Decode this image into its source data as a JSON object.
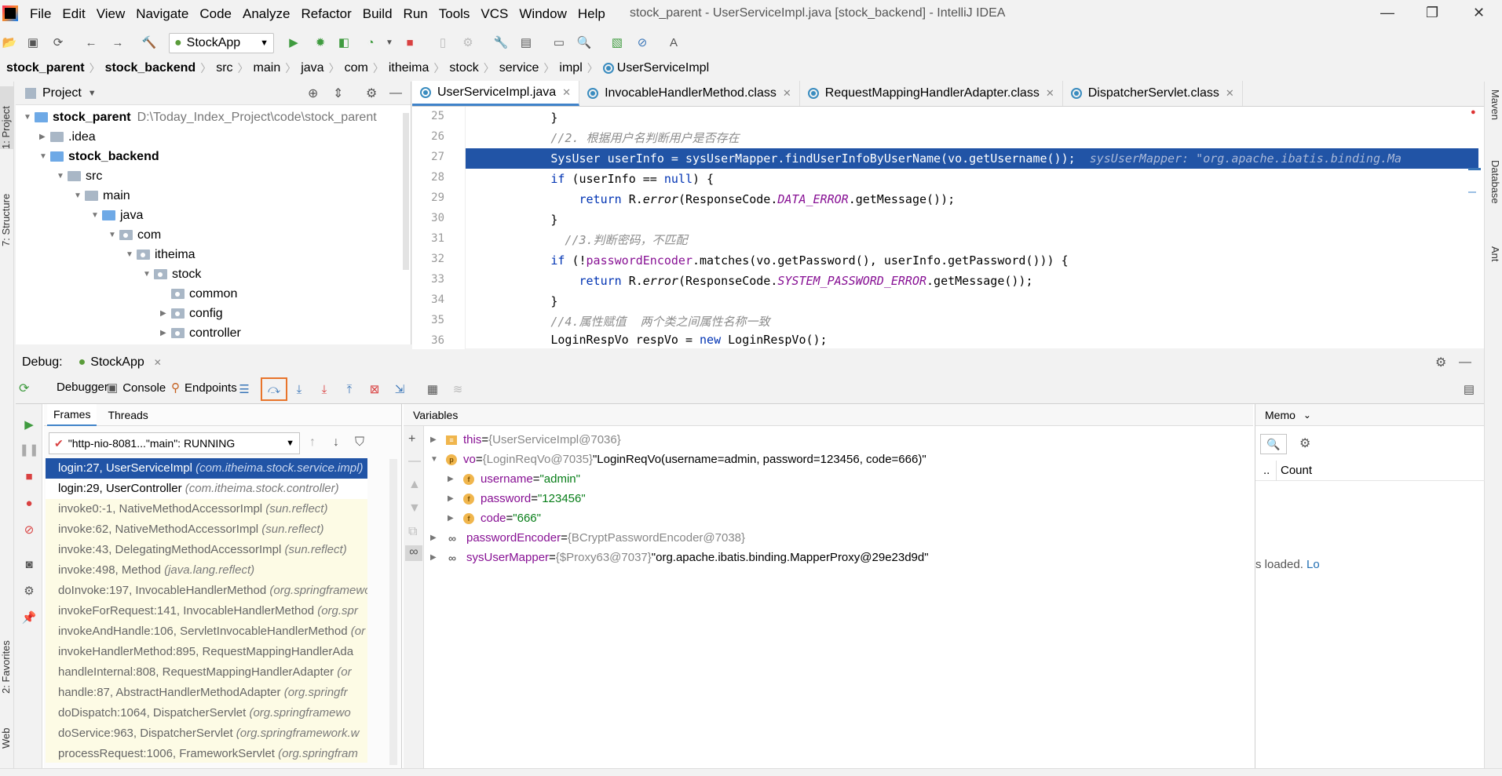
{
  "window": {
    "title": "stock_parent - UserServiceImpl.java [stock_backend] - IntelliJ IDEA"
  },
  "menu": [
    "File",
    "Edit",
    "View",
    "Navigate",
    "Code",
    "Analyze",
    "Refactor",
    "Build",
    "Run",
    "Tools",
    "VCS",
    "Window",
    "Help"
  ],
  "toolbar": {
    "run_config": "StockApp"
  },
  "breadcrumbs": [
    "stock_parent",
    "stock_backend",
    "src",
    "main",
    "java",
    "com",
    "itheima",
    "stock",
    "service",
    "impl",
    "UserServiceImpl"
  ],
  "left_stripe": {
    "project": "1: Project",
    "structure": "7: Structure",
    "favorites": "2: Favorites",
    "web": "Web"
  },
  "right_stripe": {
    "maven": "Maven",
    "database": "Database",
    "ant": "Ant"
  },
  "project": {
    "title": "Project",
    "root": {
      "name": "stock_parent",
      "path": "D:\\Today_Index_Project\\code\\stock_parent"
    },
    "items": [
      "stock_parent",
      ".idea",
      "stock_backend",
      "src",
      "main",
      "java",
      "com",
      "itheima",
      "stock",
      "common",
      "config",
      "controller"
    ]
  },
  "editor": {
    "tabs": [
      "UserServiceImpl.java",
      "InvocableHandlerMethod.class",
      "RequestMappingHandlerAdapter.class",
      "DispatcherServlet.class"
    ],
    "line_numbers": [
      "25",
      "26",
      "27",
      "28",
      "29",
      "30",
      "31",
      "32",
      "33",
      "34",
      "35",
      "36"
    ],
    "lines": {
      "l25": "            }",
      "l26": "            //2. 根据用户名判断用户是否存在",
      "l27a": "            SysUser userInfo = sysUserMapper.findUserInfoByUserName(vo.getUsername());",
      "l27b": "  sysUserMapper: \"org.apache.ibatis.binding.Ma",
      "l28a": "            ",
      "l28b": "if",
      "l28c": " (userInfo == ",
      "l28d": "null",
      "l28e": ") {",
      "l29a": "                ",
      "l29b": "return",
      "l29c": " R.",
      "l29d": "error",
      "l29e": "(ResponseCode.",
      "l29f": "DATA_ERROR",
      "l29g": ".getMessage());",
      "l30": "            }",
      "l31": "              //3.判断密码，不匹配",
      "l32a": "            ",
      "l32b": "if",
      "l32c": " (!",
      "l32d": "passwordEncoder",
      "l32e": ".matches(vo.getPassword(), userInfo.getPassword())) {",
      "l33a": "                ",
      "l33b": "return",
      "l33c": " R.",
      "l33d": "error",
      "l33e": "(ResponseCode.",
      "l33f": "SYSTEM_PASSWORD_ERROR",
      "l33g": ".getMessage());",
      "l34": "            }",
      "l35": "            //4.属性赋值  两个类之间属性名称一致",
      "l36a": "            LoginRespVo respVo = ",
      "l36b": "new",
      "l36c": " LoginRespVo();"
    }
  },
  "debug": {
    "label": "Debug:",
    "config": "StockApp",
    "tabs": {
      "debugger": "Debugger",
      "console": "Console",
      "endpoints": "Endpoints"
    },
    "frames_tab": "Frames",
    "threads_tab": "Threads",
    "thread_select": "\"http-nio-8081...\"main\": RUNNING",
    "frames": [
      {
        "m": "login:27, UserServiceImpl ",
        "p": "(com.itheima.stock.service.impl)"
      },
      {
        "m": "login:29, UserController ",
        "p": "(com.itheima.stock.controller)"
      },
      {
        "m": "invoke0:-1, NativeMethodAccessorImpl ",
        "p": "(sun.reflect)"
      },
      {
        "m": "invoke:62, NativeMethodAccessorImpl ",
        "p": "(sun.reflect)"
      },
      {
        "m": "invoke:43, DelegatingMethodAccessorImpl ",
        "p": "(sun.reflect)"
      },
      {
        "m": "invoke:498, Method ",
        "p": "(java.lang.reflect)"
      },
      {
        "m": "doInvoke:197, InvocableHandlerMethod ",
        "p": "(org.springframework"
      },
      {
        "m": "invokeForRequest:141, InvocableHandlerMethod ",
        "p": "(org.spr"
      },
      {
        "m": "invokeAndHandle:106, ServletInvocableHandlerMethod ",
        "p": "(or"
      },
      {
        "m": "invokeHandlerMethod:895, RequestMappingHandlerAda",
        "p": ""
      },
      {
        "m": "handleInternal:808, RequestMappingHandlerAdapter ",
        "p": "(or"
      },
      {
        "m": "handle:87, AbstractHandlerMethodAdapter ",
        "p": "(org.springfr"
      },
      {
        "m": "doDispatch:1064, DispatcherServlet ",
        "p": "(org.springframewo"
      },
      {
        "m": "doService:963, DispatcherServlet ",
        "p": "(org.springframework.w"
      },
      {
        "m": "processRequest:1006, FrameworkServlet ",
        "p": "(org.springfram"
      }
    ],
    "variables_label": "Variables",
    "variables": {
      "this": {
        "name": "this",
        "eq": " = ",
        "type": "{UserServiceImpl@7036}"
      },
      "vo": {
        "name": "vo",
        "eq": " = ",
        "type": "{LoginReqVo@7035} ",
        "val": "\"LoginReqVo(username=admin, password=123456, code=666)\""
      },
      "username": {
        "name": "username",
        "eq": " = ",
        "val": "\"admin\""
      },
      "password": {
        "name": "password",
        "eq": " = ",
        "val": "\"123456\""
      },
      "code": {
        "name": "code",
        "eq": " = ",
        "val": "\"666\""
      },
      "passwordEncoder": {
        "name": "passwordEncoder",
        "eq": " = ",
        "type": "{BCryptPasswordEncoder@7038}"
      },
      "sysUserMapper": {
        "name": "sysUserMapper",
        "eq": " = ",
        "type": "{$Proxy63@7037} ",
        "val": "\"org.apache.ibatis.binding.MapperProxy@29e23d9d\""
      }
    },
    "memory": {
      "tab": "Memo",
      "count": "Count",
      "dots": "..",
      "loaded": "s loaded. ",
      "link": "Lo"
    }
  }
}
